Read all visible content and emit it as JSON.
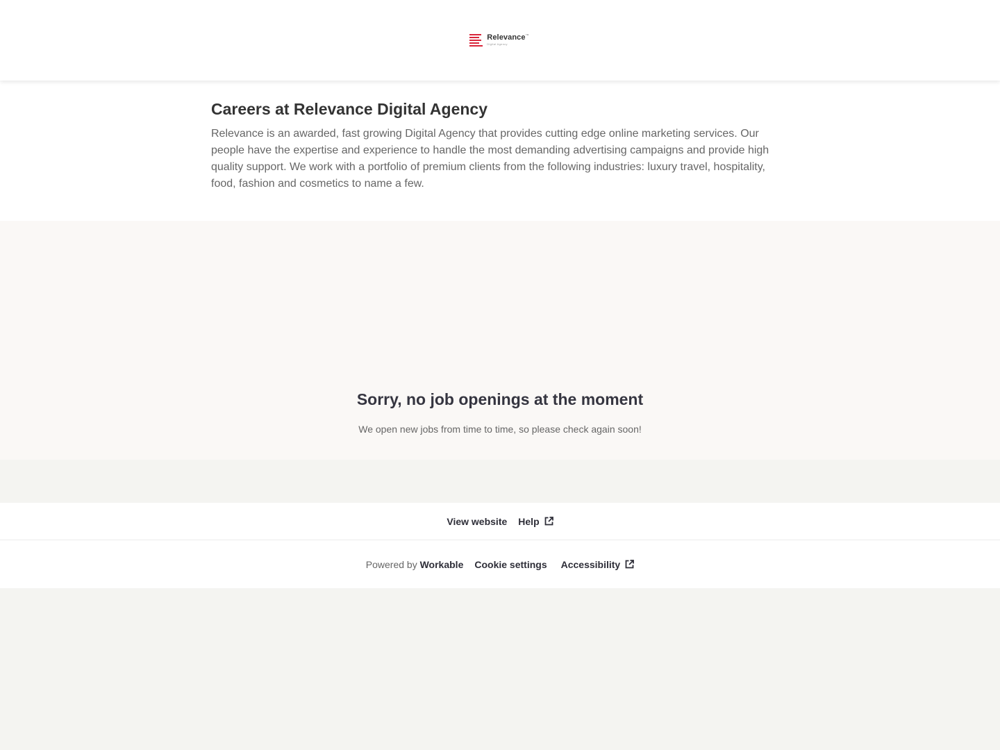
{
  "header": {
    "logo_name": "Relevance",
    "logo_tagline": "Digital Agency",
    "brand_color": "#d9263b"
  },
  "intro": {
    "title": "Careers at Relevance Digital Agency",
    "description": "Relevance is an awarded, fast growing Digital Agency that provides cutting edge online marketing services. Our people have the expertise and experience to handle the most demanding advertising campaigns and provide high quality support. We work with a portfolio of premium clients from the following industries: luxury travel, hospitality, food, fashion and cosmetics to name a few."
  },
  "jobs": {
    "empty_title": "Sorry, no job openings at the moment",
    "empty_text": "We open new jobs from time to time, so please check again soon!"
  },
  "footer": {
    "view_website": "View website",
    "help": "Help",
    "powered_by": "Powered by",
    "powered_brand": "Workable",
    "cookie_settings": "Cookie settings",
    "accessibility": "Accessibility",
    "external_icon": "external-link-icon"
  }
}
